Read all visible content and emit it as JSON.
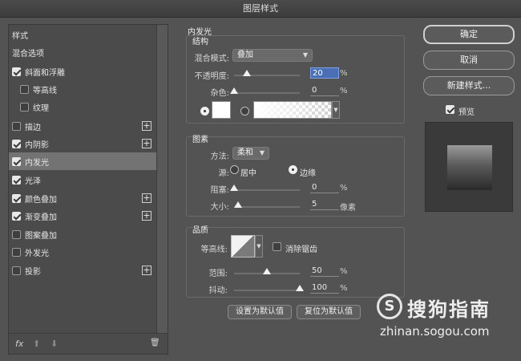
{
  "window": {
    "title": "图层样式"
  },
  "styles_list": {
    "items": [
      {
        "label": "样式",
        "checkbox": false,
        "checked": false,
        "plus": false,
        "indent": 0,
        "selected": false
      },
      {
        "label": "混合选项",
        "checkbox": false,
        "checked": false,
        "plus": false,
        "indent": 0,
        "selected": false
      },
      {
        "label": "斜面和浮雕",
        "checkbox": true,
        "checked": true,
        "plus": false,
        "indent": 0,
        "selected": false
      },
      {
        "label": "等高线",
        "checkbox": true,
        "checked": false,
        "plus": false,
        "indent": 1,
        "selected": false
      },
      {
        "label": "纹理",
        "checkbox": true,
        "checked": false,
        "plus": false,
        "indent": 1,
        "selected": false
      },
      {
        "label": "描边",
        "checkbox": true,
        "checked": false,
        "plus": true,
        "indent": 0,
        "selected": false
      },
      {
        "label": "内阴影",
        "checkbox": true,
        "checked": true,
        "plus": true,
        "indent": 0,
        "selected": false
      },
      {
        "label": "内发光",
        "checkbox": true,
        "checked": true,
        "plus": false,
        "indent": 0,
        "selected": true
      },
      {
        "label": "光泽",
        "checkbox": true,
        "checked": true,
        "plus": false,
        "indent": 0,
        "selected": false
      },
      {
        "label": "颜色叠加",
        "checkbox": true,
        "checked": true,
        "plus": true,
        "indent": 0,
        "selected": false
      },
      {
        "label": "渐变叠加",
        "checkbox": true,
        "checked": true,
        "plus": true,
        "indent": 0,
        "selected": false
      },
      {
        "label": "图案叠加",
        "checkbox": true,
        "checked": false,
        "plus": false,
        "indent": 0,
        "selected": false
      },
      {
        "label": "外发光",
        "checkbox": true,
        "checked": false,
        "plus": false,
        "indent": 0,
        "selected": false
      },
      {
        "label": "投影",
        "checkbox": true,
        "checked": false,
        "plus": true,
        "indent": 0,
        "selected": false
      }
    ],
    "footer": {
      "fx": "fx",
      "up": "⬆",
      "down": "⬇",
      "trash": "🗑"
    }
  },
  "inner_glow": {
    "title": "内发光",
    "structure": {
      "title": "结构",
      "blend_mode_label": "混合模式:",
      "blend_mode_value": "叠加",
      "opacity_label": "不透明度:",
      "opacity_value": "20",
      "opacity_pct": 20,
      "noise_label": "杂色:",
      "noise_value": "0",
      "noise_pct": 0,
      "unit": "%",
      "color_swatch": "#ffffff"
    },
    "elements": {
      "title": "图素",
      "method_label": "方法:",
      "method_value": "柔和",
      "source_label": "源:",
      "source_center": "居中",
      "source_edge": "边缘",
      "source_selected": "edge",
      "choke_label": "阻塞:",
      "choke_value": "0",
      "choke_pct": 0,
      "size_label": "大小:",
      "size_value": "5",
      "size_unit": "像素",
      "unit": "%"
    },
    "quality": {
      "title": "品质",
      "contour_label": "等高线:",
      "antialias_label": "消除锯齿",
      "range_label": "范围:",
      "range_value": "50",
      "range_pct": 50,
      "jitter_label": "抖动:",
      "jitter_value": "100",
      "jitter_pct": 100,
      "unit": "%"
    },
    "buttons": {
      "set_default": "设置为默认值",
      "reset_default": "复位为默认值"
    }
  },
  "right": {
    "ok": "确定",
    "cancel": "取消",
    "new_style": "新建样式...",
    "preview_label": "预览",
    "preview_checked": true
  },
  "watermark": {
    "logo": "S",
    "brand": "搜狗指南",
    "url": "zhinan.sogou.com"
  }
}
